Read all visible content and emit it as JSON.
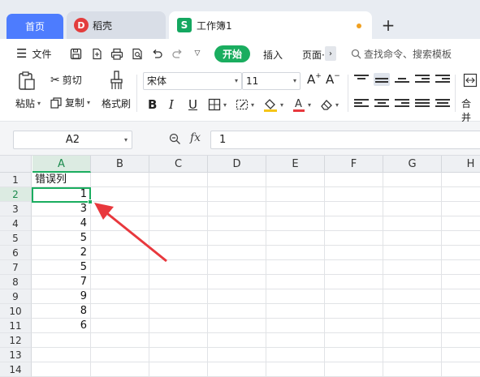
{
  "tabs": {
    "home": "首页",
    "docer": "稻壳",
    "document": "工作簿1",
    "add": "+"
  },
  "menu": {
    "file": "文件",
    "start": "开始",
    "insert": "插入",
    "page": "页面·",
    "more": "›",
    "search": "查找命令、搜索模板"
  },
  "ribbon": {
    "paste": "粘贴",
    "cut": "剪切",
    "copy": "复制",
    "format_painter": "格式刷",
    "font_name": "宋体",
    "font_size": "11",
    "bold": "B",
    "italic": "I",
    "underline": "U",
    "grow_font": "A⁺",
    "shrink_font": "A⁻",
    "merge": "合并"
  },
  "formula_bar": {
    "name_box": "A2",
    "fx": "fx",
    "value": "1"
  },
  "grid": {
    "columns": [
      "A",
      "B",
      "C",
      "D",
      "E",
      "F",
      "G",
      "H"
    ],
    "rows": [
      "1",
      "2",
      "3",
      "4",
      "5",
      "6",
      "7",
      "8",
      "9",
      "10",
      "11",
      "12",
      "13",
      "14"
    ],
    "selected_column": "A",
    "selected_row": "2",
    "cells": {
      "A1": "错误列",
      "A2": "1",
      "A3": "3",
      "A4": "4",
      "A5": "5",
      "A6": "2",
      "A7": "5",
      "A8": "7",
      "A9": "9",
      "A10": "8",
      "A11": "6"
    }
  },
  "colors": {
    "accent_green": "#1aad5f",
    "home_tab_blue": "#4d7cfe",
    "annotation_arrow": "#e8383d"
  }
}
